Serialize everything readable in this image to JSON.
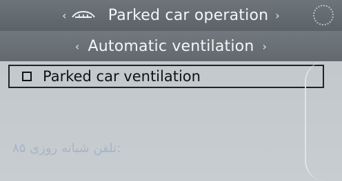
{
  "header": {
    "top_title": "Parked car operation",
    "sub_title": "Automatic ventilation"
  },
  "content": {
    "items": [
      {
        "label": "Parked car ventilation",
        "checked": false
      }
    ]
  },
  "watermark_text": "۸۵ تلفن شبانه روزی:",
  "icons": {
    "left_arrow": "left-arrow-icon",
    "right_arrow": "right-arrow-icon",
    "car_icon": "car-heater-icon",
    "dial_icon": "dial-icon",
    "checkbox_icon": "checkbox-icon"
  }
}
